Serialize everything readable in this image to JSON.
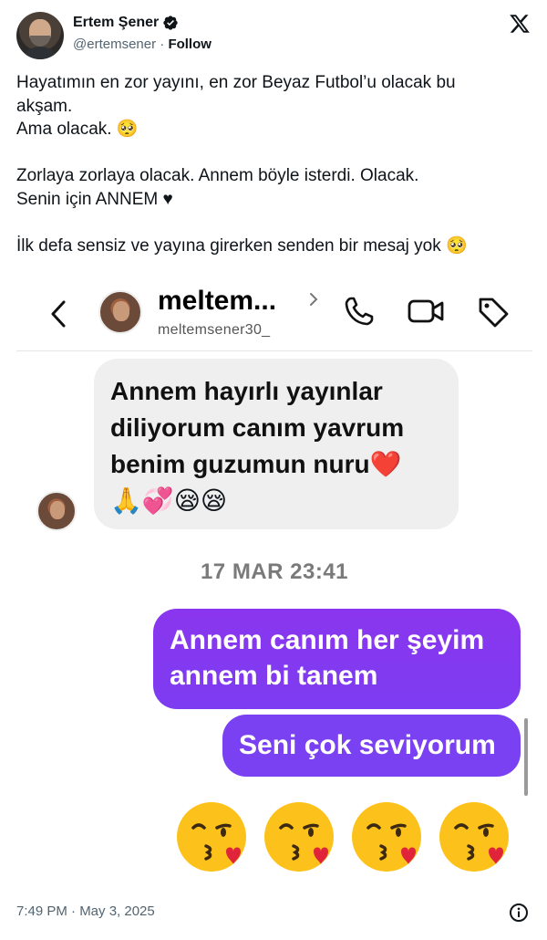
{
  "tweet": {
    "author_name": "Ertem Şener",
    "handle": "@ertemsener",
    "separator": " · ",
    "follow_label": "Follow",
    "text_lines": [
      "Hayatımın en zor yayını, en zor Beyaz Futbol’u olacak bu",
      "akşam.",
      "Ama olacak. 🥺",
      "",
      "Zorlaya zorlaya olacak. Annem böyle isterdi. Olacak.",
      "Senin için ANNEM ♥︎",
      "",
      "İlk defa sensiz ve yayına girerken senden bir mesaj yok 🥺"
    ],
    "timestamp": "7:49 PM · May 3, 2025"
  },
  "dm": {
    "contact_name": "meltem...",
    "contact_username": "meltemsener30_",
    "incoming_message": "Annem hayırlı yayınlar diliyorum canım yavrum benim guzumun  nuru❤️",
    "incoming_emojis": "🙏💞😪😪",
    "message_time": "17 MAR 23:41",
    "outgoing_1": "Annem canım her şeyim annem bi tanem",
    "outgoing_2": "Seni çok seviyorum",
    "kiss_emojis": [
      "😘",
      "😘",
      "😘",
      "😘"
    ]
  },
  "colors": {
    "bubble_purple": "#7d3cf1",
    "incoming_bubble": "#efefef",
    "verified_blue": "#1d9bf0"
  },
  "icons": [
    "verified-icon",
    "x-logo-icon",
    "back-icon",
    "chevron-right-icon",
    "phone-icon",
    "video-icon",
    "tag-icon",
    "kiss-icon",
    "info-icon"
  ]
}
